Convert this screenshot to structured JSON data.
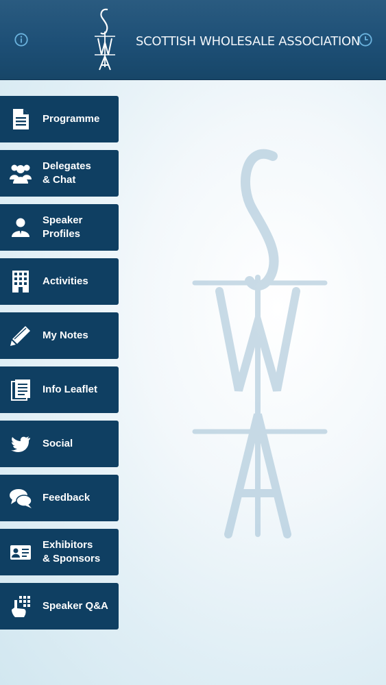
{
  "header": {
    "org_name": "SCOTTISH WHOLESALE ASSOCIATION",
    "logo_text": "SWA",
    "info_icon": "info-icon",
    "clock_icon": "clock-icon"
  },
  "watermark": {
    "text": "SWA"
  },
  "menu": {
    "items": [
      {
        "label": "Programme",
        "icon": "document-icon"
      },
      {
        "label": "Delegates\n& Chat",
        "icon": "users-icon"
      },
      {
        "label": "Speaker\nProfiles",
        "icon": "speaker-icon"
      },
      {
        "label": "Activities",
        "icon": "building-icon"
      },
      {
        "label": "My Notes",
        "icon": "pencil-icon"
      },
      {
        "label": "Info Leaflet",
        "icon": "leaflet-icon"
      },
      {
        "label": "Social",
        "icon": "twitter-icon"
      },
      {
        "label": "Feedback",
        "icon": "chat-bubbles-icon"
      },
      {
        "label": "Exhibitors\n& Sponsors",
        "icon": "id-card-icon"
      },
      {
        "label": "Speaker Q&A",
        "icon": "hand-keypad-icon"
      }
    ]
  },
  "colors": {
    "header": "#1d4f76",
    "menu_item": "#0f3f62",
    "menu_text": "#ffffff",
    "accent_icon": "#6bb3de"
  }
}
